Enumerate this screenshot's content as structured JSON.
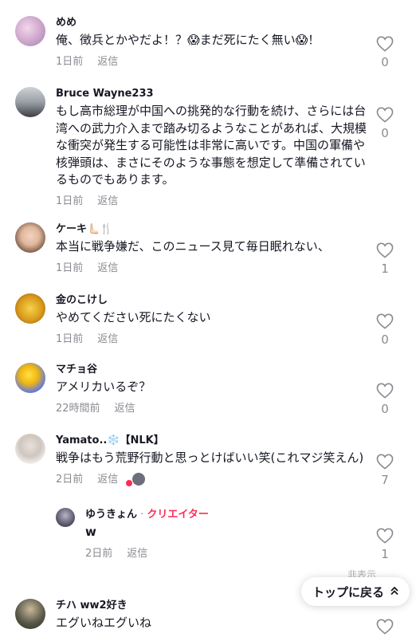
{
  "comments": [
    {
      "author": "めめ",
      "text": "俺、徴兵とかやだよ！？😱まだ死にたく無い😱！",
      "time": "1日前",
      "reply": "返信",
      "likes": "0"
    },
    {
      "author": "Bruce Wayne233",
      "text": "もし高市総理が中国への挑発的な行動を続け、さらには台湾への武力介入まで踏み切るようなことがあれば、大規模な衝突が発生する可能性は非常に高いです。中国の軍備や核弾頭は、まさにそのような事態を想定して準備されているものでもあります。",
      "time": "1日前",
      "reply": "返信",
      "likes": "0"
    },
    {
      "author": "ケーキ🫷🏻🍴",
      "text": "本当に戦争嫌だ、このニュース見て毎日眠れない、",
      "time": "1日前",
      "reply": "返信",
      "likes": "1"
    },
    {
      "author": "金のこけし",
      "text": "やめてください死にたくない",
      "time": "1日前",
      "reply": "返信",
      "likes": "0"
    },
    {
      "author": "マチョ谷",
      "text": "アメリカいるぞ？",
      "time": "22時間前",
      "reply": "返信",
      "likes": "0"
    },
    {
      "author": "Yamato..❄️【NLK】",
      "text": "戦争はもう荒野行動と思っとけばいい笑(これマジ笑えん)",
      "time": "2日前",
      "reply": "返信",
      "likes": "7"
    },
    {
      "author": "チハ ww2好き",
      "text": "エグいねエグいね"
    }
  ],
  "reply": {
    "author": "ゆうきょん",
    "separator": " · ",
    "creator_label": "クリエイター",
    "text": "w",
    "time": "2日前",
    "reply": "返信",
    "likes": "1"
  },
  "collapsed_label": "非表示",
  "back_to_top": "トップに戻る",
  "colors": {
    "accent": "#fe2c55",
    "muted": "#8a8b91"
  }
}
